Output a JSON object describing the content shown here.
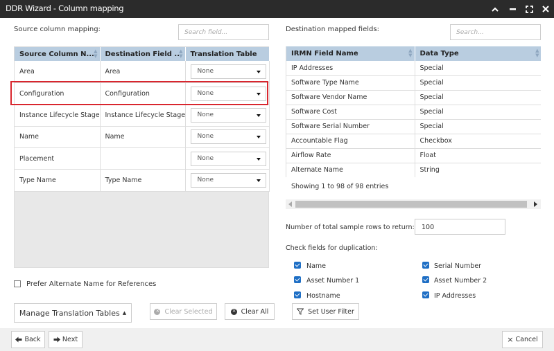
{
  "window": {
    "title": "DDR Wizard - Column mapping",
    "controls": [
      "chevron-up-icon",
      "minimize-icon",
      "maximize-icon",
      "close-icon"
    ]
  },
  "left": {
    "heading": "Source column mapping:",
    "search_placeholder": "Search field...",
    "columns": [
      "Source Column N...",
      "Destination Field ...",
      "Translation Table"
    ],
    "rows": [
      {
        "source": "Area",
        "destination": "Area",
        "translation": "None"
      },
      {
        "source": "Configuration",
        "destination": "Configuration",
        "translation": "None"
      },
      {
        "source": "Instance Lifecycle Stage",
        "destination": "Instance Lifecycle Stage",
        "translation": "None"
      },
      {
        "source": "Name",
        "destination": "Name",
        "translation": "None"
      },
      {
        "source": "Placement",
        "destination": "",
        "translation": "None"
      },
      {
        "source": "Type Name",
        "destination": "Type Name",
        "translation": "None"
      }
    ],
    "highlighted_row_color": "#d9262e",
    "prefer_alternate_label": "Prefer Alternate Name for References",
    "manage_label": "Manage Translation Tables",
    "clear_selected_label": "Clear Selected",
    "clear_all_label": "Clear All"
  },
  "right": {
    "heading": "Destination mapped fields:",
    "search_placeholder": "Search...",
    "columns": [
      "IRMN Field Name",
      "Data Type"
    ],
    "rows": [
      {
        "field": "IP Addresses",
        "type": "Special"
      },
      {
        "field": "Software Type Name",
        "type": "Special"
      },
      {
        "field": "Software Vendor Name",
        "type": "Special"
      },
      {
        "field": "Software Cost",
        "type": "Special"
      },
      {
        "field": "Software Serial Number",
        "type": "Special"
      },
      {
        "field": "Accountable Flag",
        "type": "Checkbox"
      },
      {
        "field": "Airflow Rate",
        "type": "Float"
      },
      {
        "field": "Alternate Name",
        "type": "String"
      }
    ],
    "entries_text": "Showing 1 to 98 of 98 entries",
    "sample_rows_label": "Number of total sample rows to return:",
    "sample_rows_value": "100",
    "dup_label": "Check fields for duplication:",
    "dup_fields": [
      {
        "label": "Name",
        "checked": true
      },
      {
        "label": "Serial Number",
        "checked": true
      },
      {
        "label": "Asset Number 1",
        "checked": true
      },
      {
        "label": "Asset Number 2",
        "checked": true
      },
      {
        "label": "Hostname",
        "checked": true
      },
      {
        "label": "IP Addresses",
        "checked": true
      }
    ],
    "set_filter_label": "Set User Filter"
  },
  "footer": {
    "back_label": "Back",
    "next_label": "Next",
    "cancel_label": "Cancel"
  },
  "colors": {
    "titlebar": "#2b2b2b",
    "table_header": "#b9cde0",
    "checkbox": "#1f6fc5"
  }
}
